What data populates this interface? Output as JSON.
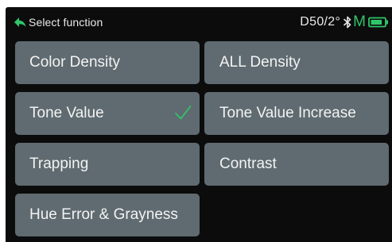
{
  "header": {
    "back_label": "Select function",
    "illuminant": "D50/2°",
    "mode": "M"
  },
  "icons": {
    "back": "back-arrow-icon",
    "bluetooth": "bluetooth-icon",
    "battery": "battery-icon",
    "check": "check-icon"
  },
  "colors": {
    "button_bg": "#5f6b70",
    "screen_bg": "#0c0c0d",
    "accent": "#2fc66a"
  },
  "functions": [
    {
      "label": "Color Density",
      "selected": false
    },
    {
      "label": "ALL Density",
      "selected": false
    },
    {
      "label": "Tone Value",
      "selected": true
    },
    {
      "label": "Tone Value Increase",
      "selected": false
    },
    {
      "label": "Trapping",
      "selected": false
    },
    {
      "label": "Contrast",
      "selected": false
    },
    {
      "label": "Hue Error & Grayness",
      "selected": false
    }
  ],
  "battery_level": 0.85
}
